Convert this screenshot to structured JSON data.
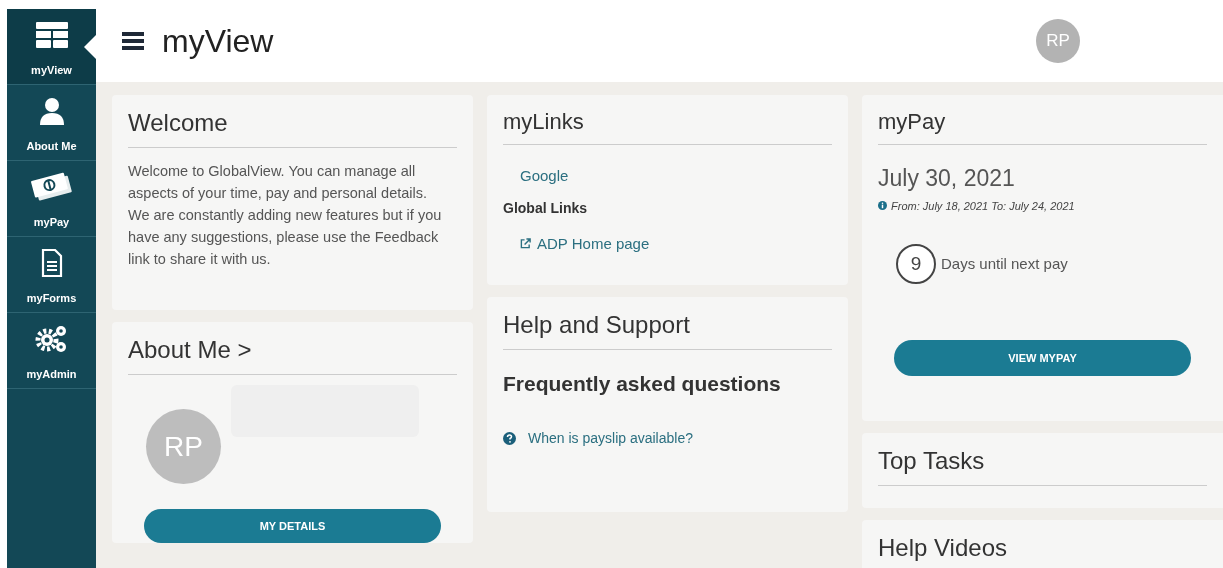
{
  "sidebar": {
    "items": [
      {
        "label": "myView",
        "selected": true
      },
      {
        "label": "About Me",
        "selected": false
      },
      {
        "label": "myPay",
        "selected": false
      },
      {
        "label": "myForms",
        "selected": false
      },
      {
        "label": "myAdmin",
        "selected": false
      }
    ]
  },
  "header": {
    "title": "myView",
    "avatar": "RP"
  },
  "welcome": {
    "title": "Welcome",
    "lines": [
      "Welcome to GlobalView. You can manage all aspects of your time, pay and personal details.",
      "We are constantly adding new features but if you have any suggestions, please use the Feedback link to share it with us."
    ]
  },
  "about_me": {
    "title": "About Me >",
    "avatar": "RP",
    "button": "MY DETAILS"
  },
  "my_links": {
    "title": "myLinks",
    "links": [
      "Google"
    ],
    "section": "Global Links",
    "global_links": [
      "ADP Home page"
    ]
  },
  "help": {
    "title": "Help and Support",
    "subtitle": "Frequently asked questions",
    "questions": [
      "When is payslip available?"
    ]
  },
  "my_pay": {
    "title": "myPay",
    "date": "July 30, 2021",
    "period": "From: July 18, 2021 To: July 24, 2021",
    "days": "9",
    "days_label": "Days until next pay",
    "button": "VIEW MYPAY"
  },
  "top_tasks": {
    "title": "Top Tasks"
  },
  "help_videos": {
    "title": "Help Videos"
  }
}
